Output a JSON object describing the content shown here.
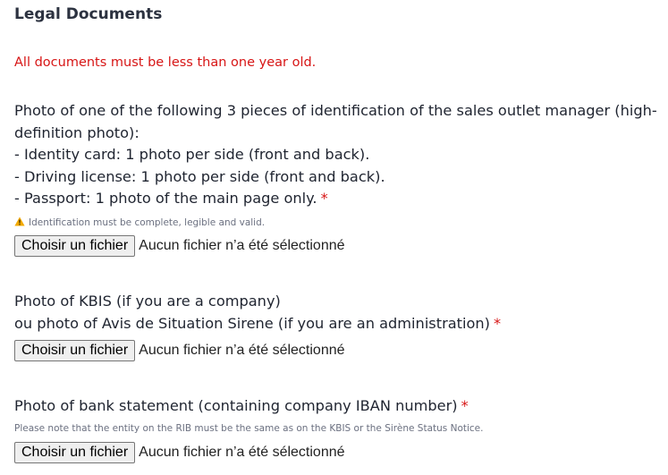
{
  "section": {
    "title": "Legal Documents",
    "notice": "All documents must be less than one year old."
  },
  "fields": [
    {
      "label_lines": [
        "Photo of one of the following 3 pieces of identification of the sales outlet manager (high-",
        "definition photo):",
        "- Identity card: 1 photo per side (front and back).",
        "- Driving license: 1 photo per side (front and back).",
        "- Passport: 1 photo of the main page only."
      ],
      "required_mark": "*",
      "hint": "Identification must be complete, legible and valid.",
      "hint_icon": "warning-icon",
      "button_label": "Choisir un fichier",
      "status": "Aucun fichier n’a été sélectionné"
    },
    {
      "label_lines": [
        "Photo of KBIS (if you are a company)",
        "ou photo of Avis de Situation Sirene (if you are an administration)"
      ],
      "required_mark": "*",
      "button_label": "Choisir un fichier",
      "status": "Aucun fichier n’a été sélectionné"
    },
    {
      "label_lines": [
        "Photo of bank statement (containing company IBAN number)"
      ],
      "required_mark": "*",
      "hint": "Please note that the entity on the RIB must be the same as on the KBIS or the Sirène Status Notice.",
      "button_label": "Choisir un fichier",
      "status": "Aucun fichier n’a été sélectionné"
    }
  ],
  "colors": {
    "required": "#d71515",
    "notice": "#d71515",
    "warning_icon": "#f2a900"
  }
}
